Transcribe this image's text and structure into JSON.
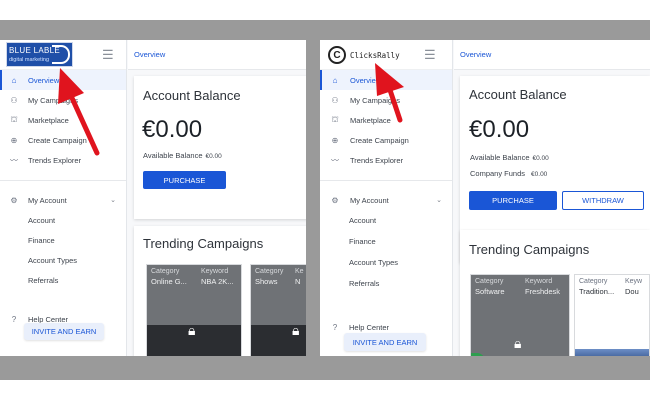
{
  "left": {
    "logo": {
      "line1": "BLUE LABLE",
      "line2": "digital marketing"
    },
    "nav": [
      {
        "label": "Overview",
        "icon": "home-icon",
        "glyph": "⌂",
        "active": true
      },
      {
        "label": "My Campaigns",
        "icon": "people-icon",
        "glyph": "⚇",
        "active": false
      },
      {
        "label": "Marketplace",
        "icon": "store-icon",
        "glyph": "⛫",
        "active": false
      },
      {
        "label": "Create Campaign",
        "icon": "plus-circle-icon",
        "glyph": "⊕",
        "active": false
      },
      {
        "label": "Trends Explorer",
        "icon": "trend-icon",
        "glyph": "〰",
        "active": false
      }
    ],
    "account": {
      "label": "My Account",
      "glyph": "⚙",
      "sub": [
        "Account",
        "Finance",
        "Account Types",
        "Referrals"
      ]
    },
    "help": {
      "label": "Help Center",
      "glyph": "?"
    },
    "invite": "INVITE AND EARN",
    "breadcrumb": "Overview",
    "balance": {
      "title": "Account Balance",
      "amount": "€0.00",
      "available_label": "Available Balance",
      "available_value": "€0.00",
      "purchase": "PURCHASE"
    },
    "trending": {
      "title": "Trending Campaigns",
      "cards": [
        {
          "h1": "Category",
          "h2": "Keyword",
          "v1": "Online G...",
          "v2": "NBA 2K..."
        },
        {
          "h1": "Category",
          "h2": "Ke",
          "v1": "Shows",
          "v2": "N"
        }
      ]
    }
  },
  "right": {
    "logo": {
      "letter": "C",
      "word": "ClicksRally"
    },
    "nav": [
      {
        "label": "Overview",
        "icon": "home-icon",
        "glyph": "⌂",
        "active": true
      },
      {
        "label": "My Campaigns",
        "icon": "people-icon",
        "glyph": "⚇",
        "active": false
      },
      {
        "label": "Marketplace",
        "icon": "store-icon",
        "glyph": "⛫",
        "active": false
      },
      {
        "label": "Create Campaign",
        "icon": "plus-circle-icon",
        "glyph": "⊕",
        "active": false
      },
      {
        "label": "Trends Explorer",
        "icon": "trend-icon",
        "glyph": "〰",
        "active": false
      }
    ],
    "account": {
      "label": "My Account",
      "glyph": "⚙",
      "sub": [
        "Account",
        "Finance",
        "Account Types",
        "Referrals"
      ]
    },
    "help": {
      "label": "Help Center",
      "glyph": "?"
    },
    "invite": "INVITE AND EARN",
    "breadcrumb": "Overview",
    "balance": {
      "title": "Account Balance",
      "amount": "€0.00",
      "available_label": "Available Balance",
      "available_value": "€0.00",
      "funds_label": "Company Funds",
      "funds_value": "€0.00",
      "purchase": "PURCHASE",
      "withdraw": "WITHDRAW"
    },
    "trending": {
      "title": "Trending Campaigns",
      "cards": [
        {
          "h1": "Category",
          "h2": "Keyword",
          "v1": "Software",
          "v2": "Freshdesk"
        },
        {
          "h1": "Category",
          "h2": "Keyw",
          "v1": "Tradition...",
          "v2": "Dou"
        }
      ]
    }
  },
  "colors": {
    "accent": "#1a56d6",
    "arrow": "#e0141e",
    "band": "#9a9a9a"
  },
  "icons": {
    "menu": "hamburger-icon",
    "lock": "lock-icon",
    "chevron": "chevron-down-icon"
  }
}
